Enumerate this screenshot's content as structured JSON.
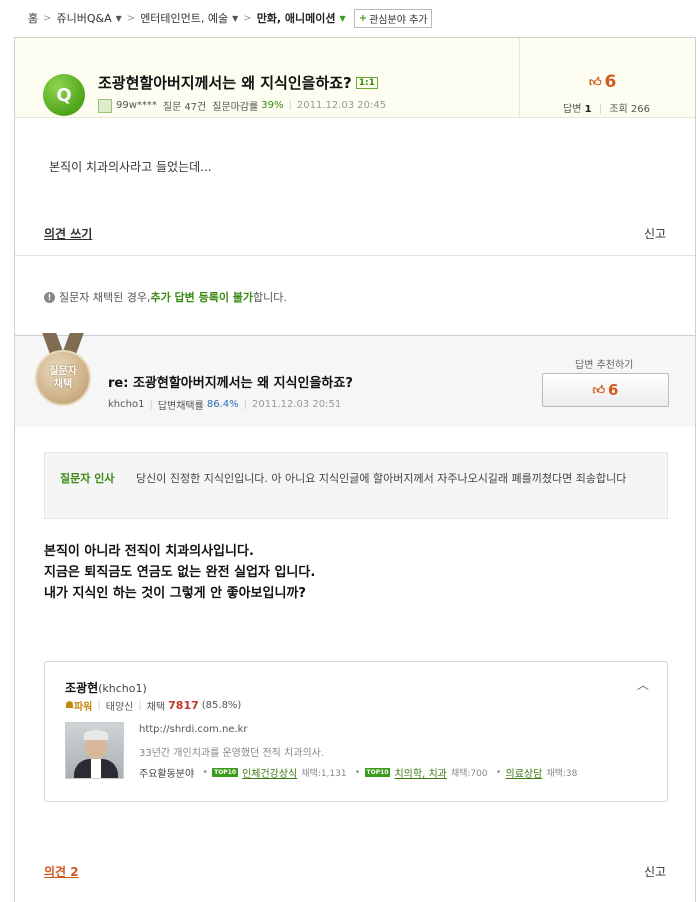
{
  "breadcrumb": {
    "home": "홈",
    "q_and_a": "쥬니버Q&A",
    "category": "엔터테인먼트, 예술",
    "current": "만화, 애니메이션",
    "interest_button": "관심분야 추가"
  },
  "question": {
    "badge": "Q",
    "title": "조광현할아버지께서는 왜 지식인을하죠?",
    "one_on_one_tag": "1:1",
    "author": "99w****",
    "question_label": "질문",
    "question_count": "47건",
    "close_rate_label": "질문마감률",
    "close_rate": "39%",
    "date": "2011.12.03 20:45",
    "recommend_count": "6",
    "answers_label": "답변",
    "answers_count": "1",
    "views_label": "조회",
    "views_count": "266",
    "body": "본직이 치과의사라고 들었는데...",
    "opinion_link": "의견 쓰기",
    "report_link": "신고"
  },
  "notice": {
    "prefix": "질문자 채택된 경우, ",
    "emphasis": "추가 답변 등록이 불가",
    "suffix": "합니다."
  },
  "answer": {
    "medal_line1": "질문자",
    "medal_line2": "채택",
    "title": "re: 조광현할아버지께서는 왜 지식인을하죠?",
    "author": "khcho1",
    "adopt_rate_label": "답변채택률",
    "adopt_rate": "86.4%",
    "date": "2011.12.03 20:51",
    "recommend_label": "답변 추천하기",
    "recommend_count": "6",
    "asker_note_label": "질문자 인사",
    "asker_note_text": "당신이 진정한 지식인입니다. 아 아니요 지식인글에 할아버지께서 자주나오시길래 폐를끼쳤다면 죄송합니다",
    "body_lines": [
      "본직이 아니라 전직이 치과의사입니다.",
      "지금은 퇴직금도 연금도 없는 완전 실업자 입니다.",
      "내가 지식인 하는 것이 그렇게 안 좋아보입니까?"
    ],
    "opinion_link": "의견 2",
    "report_link": "신고"
  },
  "profile": {
    "name": "조광현",
    "id": "(khcho1)",
    "power_label": "파워",
    "level": "태양신",
    "adopt_label": "채택",
    "adopt_count": "7817",
    "adopt_rate": "(85.8%)",
    "url": "http://shrdi.com.ne.kr",
    "description": "33년간 개인치과를 운영했던 전직 치과의사.",
    "areas_label": "주요활동분야",
    "top10_badge": "TOP10",
    "areas": [
      {
        "name": "인체건강상식",
        "count": "채택:1,131"
      },
      {
        "name": "치의학, 치과",
        "count": "채택:700"
      },
      {
        "name": "의료상담",
        "count": "채택:38"
      }
    ]
  }
}
